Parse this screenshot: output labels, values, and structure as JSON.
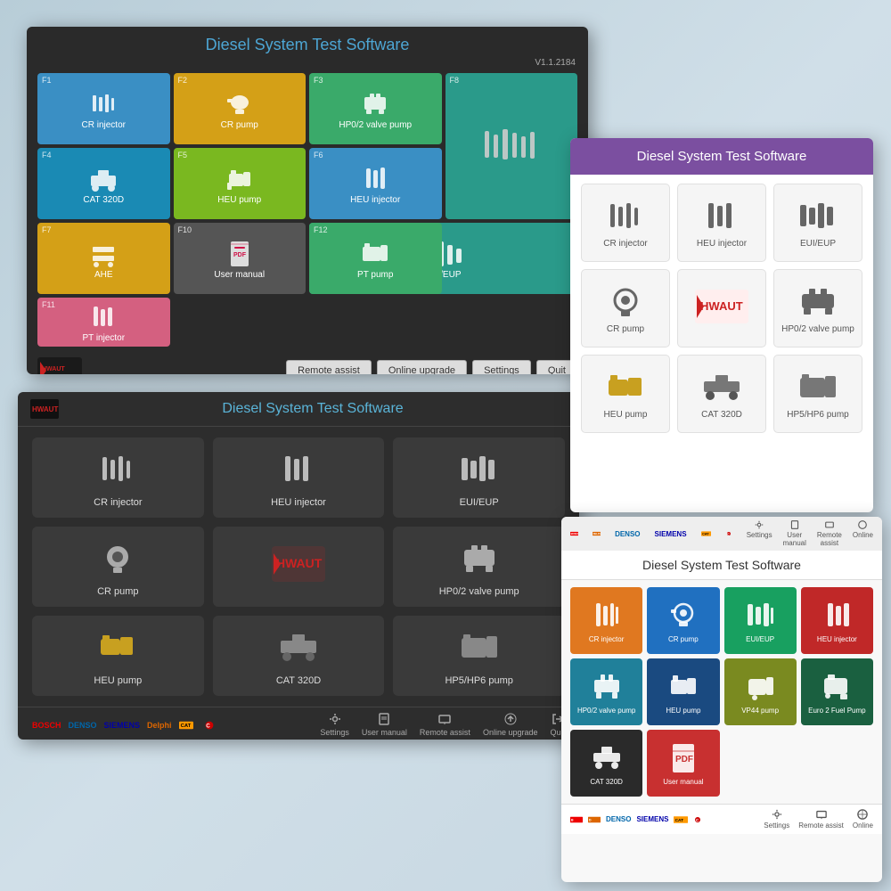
{
  "window1": {
    "title": "Diesel System Test Software",
    "version": "V1.1.2184",
    "tiles": [
      {
        "fkey": "F1",
        "label": "CR injector",
        "color": "tile-blue"
      },
      {
        "fkey": "F2",
        "label": "CR pump",
        "color": "tile-yellow"
      },
      {
        "fkey": "F3",
        "label": "HP0/2 valve pump",
        "color": "tile-green"
      },
      {
        "fkey": "F8",
        "label": "",
        "color": "tile-teal",
        "large": true
      },
      {
        "fkey": "F4",
        "label": "CAT 320D",
        "color": "tile-cyan"
      },
      {
        "fkey": "F5",
        "label": "HEU pump",
        "color": "tile-lime"
      },
      {
        "fkey": "F6",
        "label": "HEU injector",
        "color": "tile-blue"
      },
      {
        "fkey": "F7",
        "label": "AHE",
        "color": "tile-yellow"
      },
      {
        "fkey": "",
        "label": "EUI/EUP",
        "color": "tile-teal",
        "large": true
      },
      {
        "fkey": "F10",
        "label": "User manual",
        "color": "tile-gray"
      },
      {
        "fkey": "F11",
        "label": "PT injector",
        "color": "tile-pink"
      },
      {
        "fkey": "F12",
        "label": "PT pump",
        "color": "tile-green"
      }
    ],
    "footer_buttons": [
      "Remote assist",
      "Online upgrade",
      "Settings",
      "Quit"
    ]
  },
  "window2": {
    "title": "Diesel System Test Software",
    "cards": [
      {
        "label": "CR injector"
      },
      {
        "label": "HEU injector"
      },
      {
        "label": "EUI/EUP"
      },
      {
        "label": "CR pump"
      },
      {
        "label": "HWAUT"
      },
      {
        "label": "HP0/2 valve pump"
      },
      {
        "label": "HEU pump"
      },
      {
        "label": "CAT 320D"
      },
      {
        "label": "HP5/HP6 pump"
      }
    ],
    "brands": [
      "BOSCH",
      "DENSO",
      "SIEMENS",
      "Delphi",
      "CAT"
    ],
    "footer_actions": [
      "Settings",
      "User manual",
      "Remote assist",
      "Online upgrade",
      "Quit"
    ]
  },
  "window3": {
    "title": "Diesel System Test Software",
    "cards": [
      {
        "label": "CR injector"
      },
      {
        "label": "HEU injector"
      },
      {
        "label": "EUI/EUP"
      },
      {
        "label": "CR pump"
      },
      {
        "label": "HWAUT"
      },
      {
        "label": "HP0/2 valve pump"
      },
      {
        "label": "HEU pump"
      },
      {
        "label": "CAT 320D"
      },
      {
        "label": "HP5/HP6 pump"
      }
    ]
  },
  "window4": {
    "title": "Diesel System Test Software",
    "top_brands": [
      "BOSCH",
      "Delphi",
      "DENSO",
      "SIEMENS",
      "CAT"
    ],
    "top_actions": [
      "Settings",
      "User manual",
      "Remote assist",
      "Online"
    ],
    "tiles": [
      {
        "label": "CR injector",
        "color": "ctile-orange"
      },
      {
        "label": "CR pump",
        "color": "ctile-blue2"
      },
      {
        "label": "EUI/EUP",
        "color": "ctile-green2"
      },
      {
        "label": "HEU injector",
        "color": "ctile-red2"
      },
      {
        "label": "HP0/2 valve pump",
        "color": "ctile-teal2"
      },
      {
        "label": "HEU pump",
        "color": "ctile-darkblue"
      },
      {
        "label": "VP44 pump",
        "color": "ctile-olive"
      },
      {
        "label": "Euro 2 Fuel Pump",
        "color": "ctile-darkgreen"
      },
      {
        "label": "CAT 320D",
        "color": "ctile-nearblack"
      },
      {
        "label": "User manual",
        "color": "ctile-pdf"
      }
    ],
    "footer_brands": [
      "BOSCH",
      "Delphi",
      "DENSO",
      "SIEMENS",
      "CAT"
    ],
    "footer_actions": [
      "Settings",
      "Remote assist",
      "Online"
    ]
  },
  "icons": {
    "injector": "⚡",
    "pump": "⚙",
    "pdf": "📄",
    "hwaut_text": "HWAUT"
  }
}
